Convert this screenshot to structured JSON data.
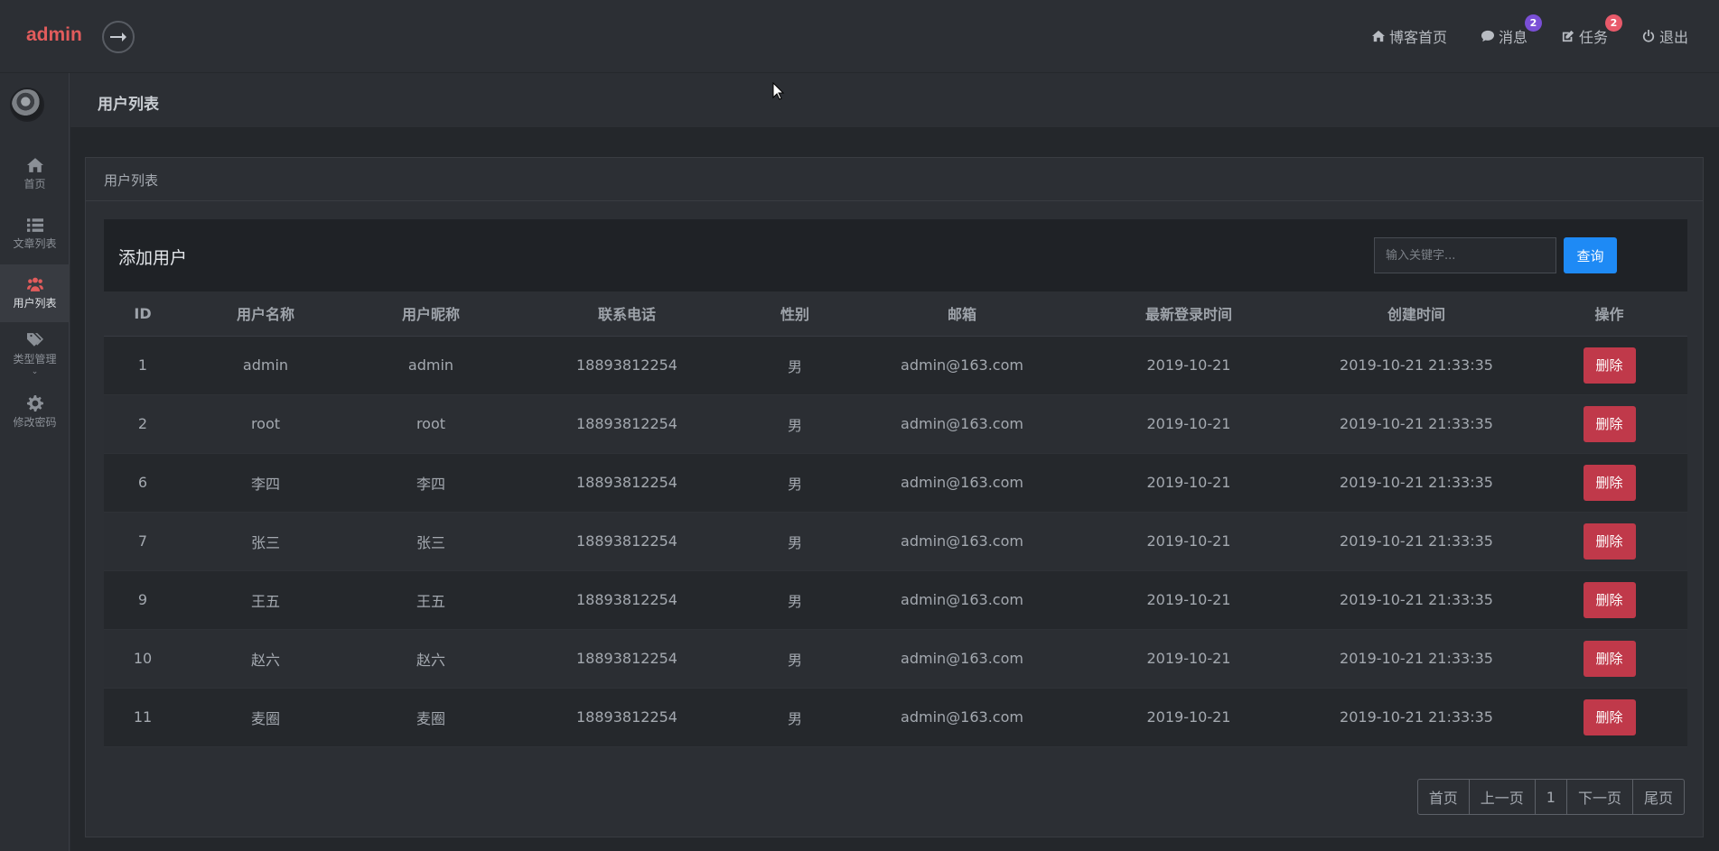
{
  "header": {
    "brand": "admin",
    "nav": [
      {
        "label": "博客首页",
        "icon": "home-icon"
      },
      {
        "label": "消息",
        "icon": "comment-icon",
        "badge": "2"
      },
      {
        "label": "任务",
        "icon": "edit-icon",
        "badge": "2"
      },
      {
        "label": "退出",
        "icon": "power-icon"
      }
    ]
  },
  "sidebar": {
    "items": [
      {
        "label": "首页",
        "icon": "home-icon"
      },
      {
        "label": "文章列表",
        "icon": "list-icon"
      },
      {
        "label": "用户列表",
        "icon": "users-icon",
        "active": true
      },
      {
        "label": "类型管理",
        "icon": "tags-icon"
      },
      {
        "label": "修改密码",
        "icon": "gear-icon"
      }
    ]
  },
  "page": {
    "title": "用户列表",
    "panel_title": "用户列表",
    "add_user": "添加用户",
    "search_placeholder": "输入关键字...",
    "search_button": "查询"
  },
  "table": {
    "columns": [
      "ID",
      "用户名称",
      "用户昵称",
      "联系电话",
      "性别",
      "邮箱",
      "最新登录时间",
      "创建时间",
      "操作"
    ],
    "delete_label": "删除",
    "rows": [
      [
        "1",
        "admin",
        "admin",
        "18893812254",
        "男",
        "admin@163.com",
        "2019-10-21",
        "2019-10-21 21:33:35"
      ],
      [
        "2",
        "root",
        "root",
        "18893812254",
        "男",
        "admin@163.com",
        "2019-10-21",
        "2019-10-21 21:33:35"
      ],
      [
        "6",
        "李四",
        "李四",
        "18893812254",
        "男",
        "admin@163.com",
        "2019-10-21",
        "2019-10-21 21:33:35"
      ],
      [
        "7",
        "张三",
        "张三",
        "18893812254",
        "男",
        "admin@163.com",
        "2019-10-21",
        "2019-10-21 21:33:35"
      ],
      [
        "9",
        "王五",
        "王五",
        "18893812254",
        "男",
        "admin@163.com",
        "2019-10-21",
        "2019-10-21 21:33:35"
      ],
      [
        "10",
        "赵六",
        "赵六",
        "18893812254",
        "男",
        "admin@163.com",
        "2019-10-21",
        "2019-10-21 21:33:35"
      ],
      [
        "11",
        "麦圈",
        "麦圈",
        "18893812254",
        "男",
        "admin@163.com",
        "2019-10-21",
        "2019-10-21 21:33:35"
      ]
    ]
  },
  "pagination": {
    "first": "首页",
    "prev": "上一页",
    "current": "1",
    "next": "下一页",
    "last": "尾页"
  },
  "colors": {
    "brand": "#e25c5c",
    "primary": "#1e8af5",
    "danger": "#c0394a",
    "badge_purple": "#7a4fd6",
    "badge_red": "#e85a6a"
  }
}
